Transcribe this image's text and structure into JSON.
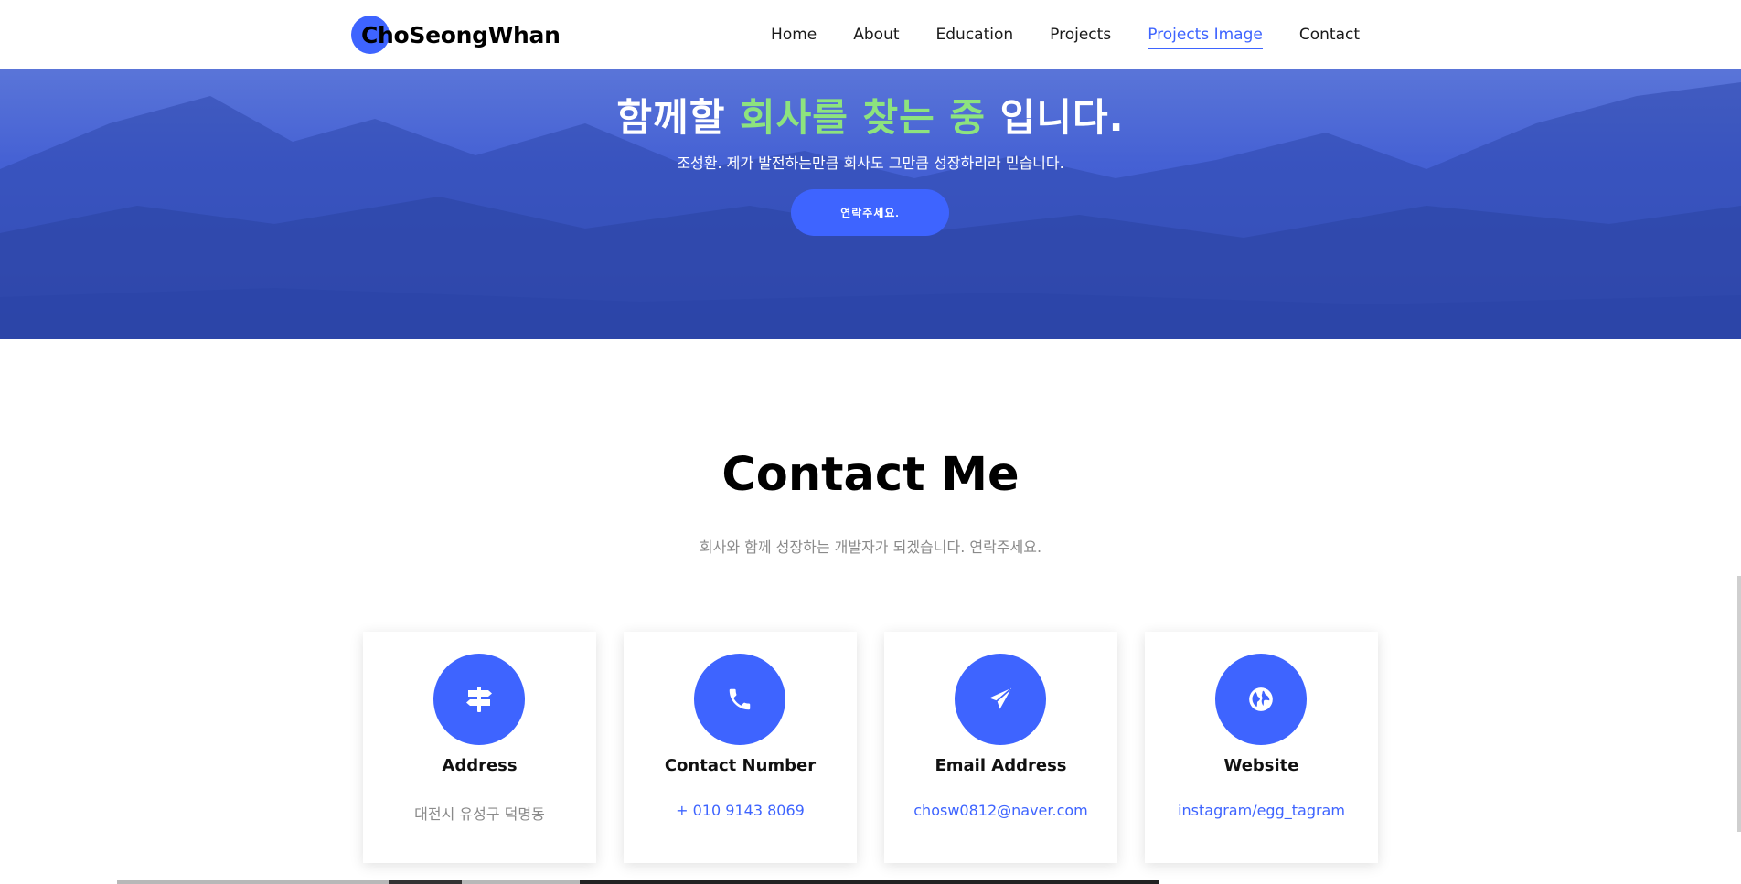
{
  "brand": {
    "name": "ChoSeongWhan"
  },
  "nav": {
    "items": [
      {
        "label": "Home"
      },
      {
        "label": "About"
      },
      {
        "label": "Education"
      },
      {
        "label": "Projects"
      },
      {
        "label": "Projects Image",
        "active": true
      },
      {
        "label": "Contact"
      }
    ]
  },
  "hero": {
    "title_part1": "함께할 ",
    "title_highlight": "회사를 찾는 중",
    "title_part2": " 입니다.",
    "subtitle": "조성환. 제가 발전하는만큼 회사도 그만큼 성장하리라 믿습니다.",
    "button_label": "연락주세요."
  },
  "contact": {
    "title": "Contact Me",
    "subtitle": "회사와 함께 성장하는 개발자가 되겠습니다. 연락주세요.",
    "cards": [
      {
        "icon": "signpost-icon",
        "title": "Address",
        "value": "대전시 유성구 덕명동"
      },
      {
        "icon": "phone-icon",
        "title": "Contact Number",
        "value": "+ 010 9143 8069"
      },
      {
        "icon": "paper-plane-icon",
        "title": "Email Address",
        "value": "chosw0812@naver.com"
      },
      {
        "icon": "globe-icon",
        "title": "Website",
        "value": "instagram/egg_tagram"
      }
    ]
  },
  "colors": {
    "accent": "#3e64ff",
    "hero_overlay": "#4561d4",
    "highlight": "#8de37e",
    "muted_text": "#8a8a8a"
  }
}
